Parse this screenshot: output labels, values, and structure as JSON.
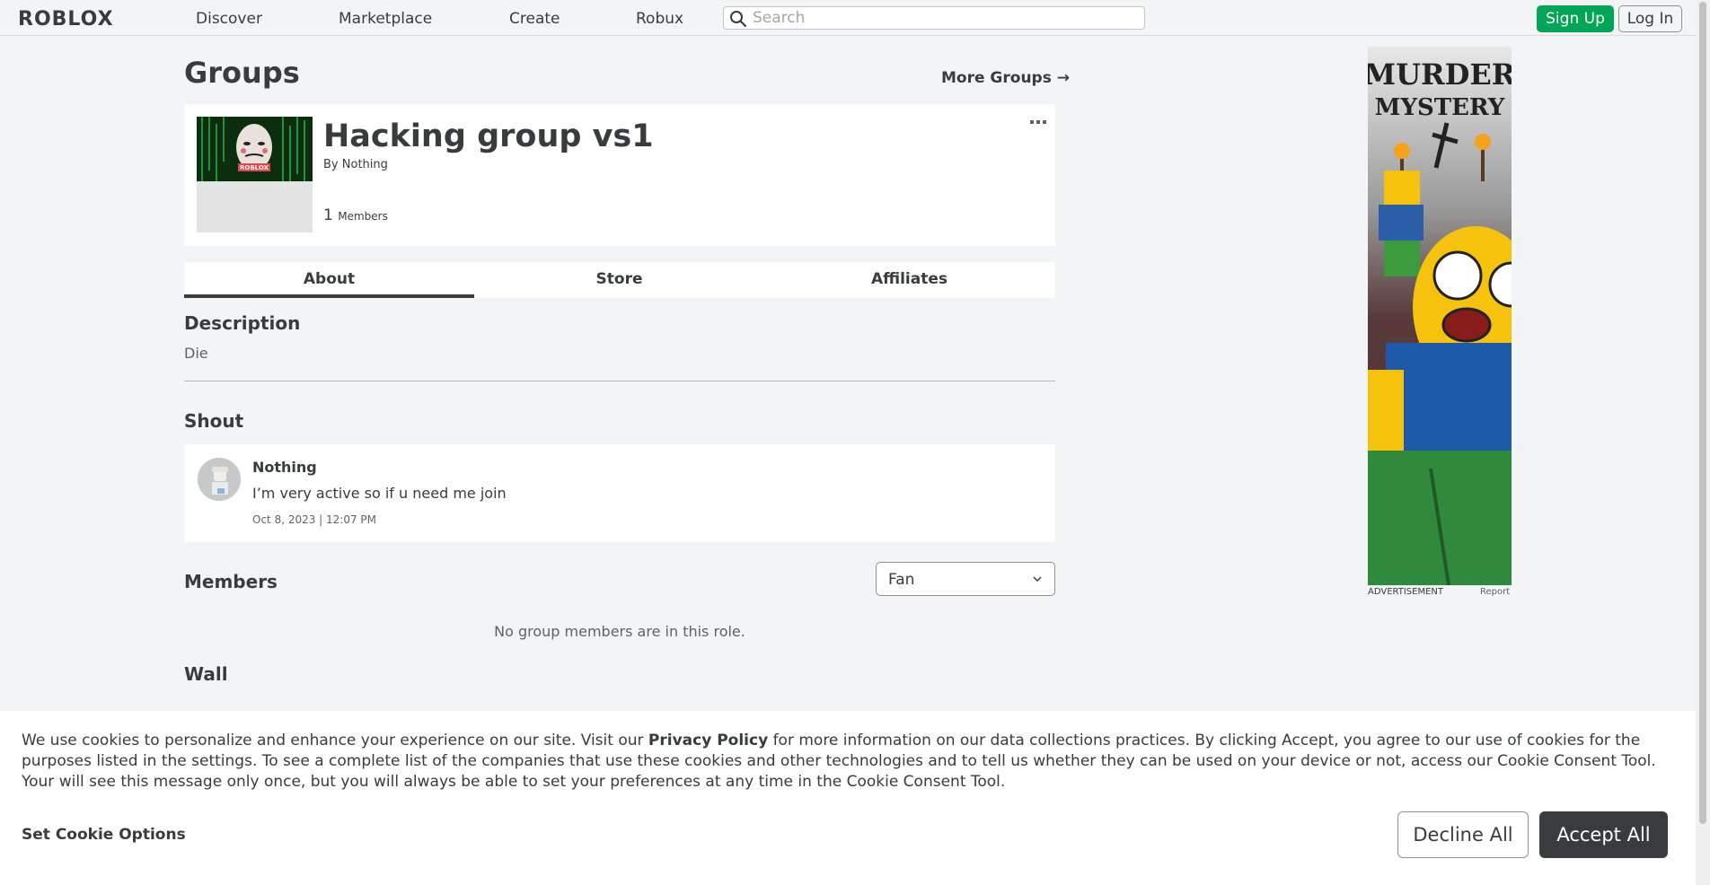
{
  "header": {
    "logo": "ROBLOX",
    "nav": [
      "Discover",
      "Marketplace",
      "Create",
      "Robux"
    ],
    "search_placeholder": "Search",
    "signup_label": "Sign Up",
    "login_label": "Log In"
  },
  "page": {
    "title": "Groups",
    "more_groups": "More Groups →"
  },
  "group": {
    "name": "Hacking group vs1",
    "by_prefix": "By",
    "owner": "Nothing",
    "member_count": "1",
    "member_label": "Members",
    "emblem_text": "ROBLOX"
  },
  "tabs": [
    "About",
    "Store",
    "Affiliates"
  ],
  "about": {
    "description_title": "Description",
    "description": "Die",
    "shout_title": "Shout",
    "shout": {
      "user": "Nothing",
      "text": "I’m very active so if u need me join",
      "date": "Oct 8, 2023 | 12:07 PM"
    },
    "members_title": "Members",
    "role_selected": "Fan",
    "no_members": "No group members are in this role.",
    "wall_title": "Wall"
  },
  "ad": {
    "line1": "MURDER",
    "line2": "MYSTERY",
    "label": "ADVERTISEMENT",
    "report": "Report"
  },
  "cookie": {
    "text_before": "We use cookies to personalize and enhance your experience on our site. Visit our ",
    "privacy_link": "Privacy Policy",
    "text_after": " for more information on our data collections practices. By clicking Accept, you agree to our use of cookies for the purposes listed in the settings. To see a complete list of the companies that use these cookies and other technologies and to tell us whether they can be used on your device or not, access our Cookie Consent Tool. Your will see this message only once, but you will always be able to set your preferences at any time in the Cookie Consent Tool.",
    "options_label": "Set Cookie Options",
    "decline_label": "Decline All",
    "accept_label": "Accept All"
  },
  "colors": {
    "signup_green": "#00a555",
    "text_dark": "#393b3d",
    "background": "#f2f4f5"
  }
}
